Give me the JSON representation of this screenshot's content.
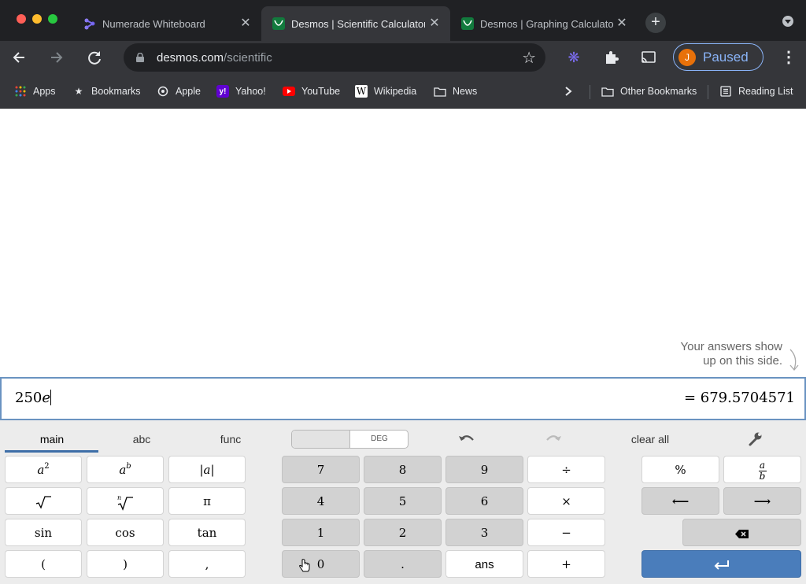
{
  "browser": {
    "tabs": [
      {
        "title": "Numerade Whiteboard",
        "icon": "numerade-icon",
        "active": false
      },
      {
        "title": "Desmos | Scientific Calculator",
        "icon": "desmos-icon",
        "active": true
      },
      {
        "title": "Desmos | Graphing Calculator",
        "icon": "desmos-icon",
        "active": false
      }
    ],
    "url_host": "desmos.com",
    "url_path": "/scientific",
    "profile_initial": "J",
    "profile_status": "Paused",
    "bookmarks": [
      "Apps",
      "Bookmarks",
      "Apple",
      "Yahoo!",
      "YouTube",
      "Wikipedia",
      "News"
    ],
    "other_bookmarks": "Other Bookmarks",
    "reading_list": "Reading List",
    "accent": "#8ab4f8"
  },
  "calculator": {
    "hint_line1": "Your answers show",
    "hint_line2": "up on this side.",
    "expression_number": "250",
    "expression_symbol": "e",
    "result": "= 679.5704571",
    "tabs": [
      "main",
      "abc",
      "func"
    ],
    "active_tab": "main",
    "angle_mode": "DEG",
    "clear_all": "clear all",
    "keys_left": {
      "row1": [
        "|a|"
      ],
      "row2": [
        "π"
      ],
      "row3": [
        "sin",
        "cos",
        "tan"
      ],
      "row4": [
        "(",
        ")",
        ","
      ]
    },
    "keys_numpad": {
      "row1": [
        "7",
        "8",
        "9",
        "÷"
      ],
      "row2": [
        "4",
        "5",
        "6",
        "×"
      ],
      "row3": [
        "1",
        "2",
        "3",
        "−"
      ],
      "row4": [
        "0",
        ".",
        "ans",
        "+"
      ]
    },
    "keys_right": {
      "percent": "%",
      "frac_num": "a",
      "frac_den": "b",
      "left": "⟵",
      "right": "⟶",
      "enter": "↵"
    },
    "enter_color": "#4a7dbb"
  }
}
